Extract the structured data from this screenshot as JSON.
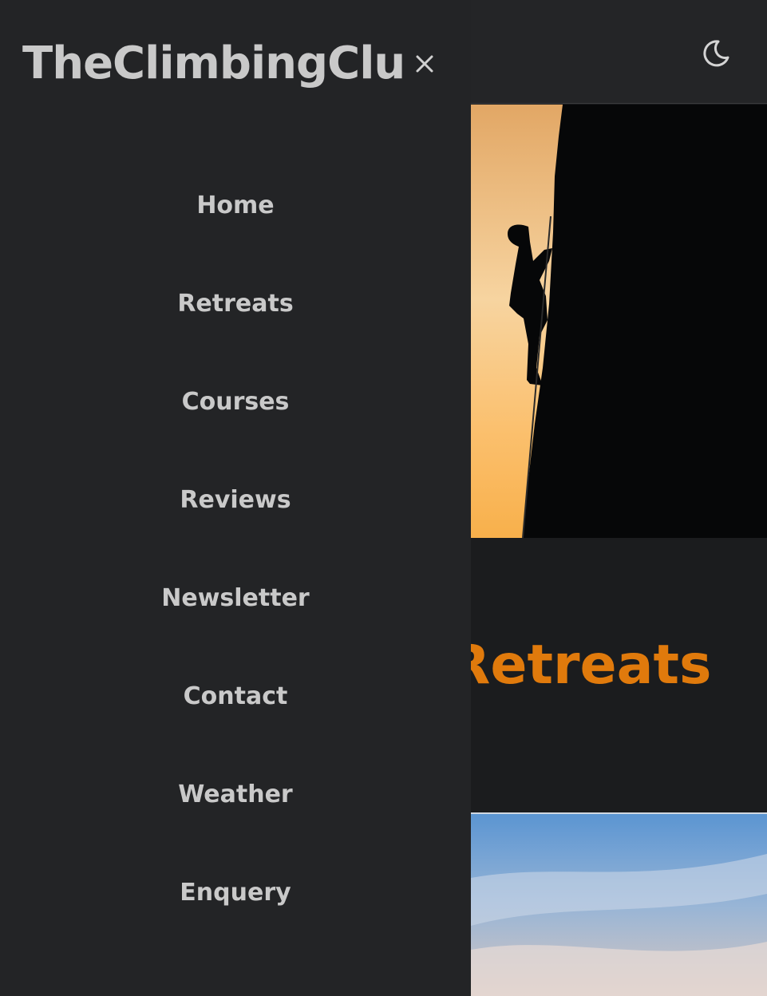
{
  "app": {
    "brand": "TheClimbingClub"
  },
  "header": {
    "theme_toggle_icon": "moon-icon"
  },
  "drawer": {
    "close_icon": "close-icon",
    "close_label": "×",
    "items": [
      {
        "label": "Home"
      },
      {
        "label": "Retreats"
      },
      {
        "label": "Courses"
      },
      {
        "label": "Reviews"
      },
      {
        "label": "Newsletter"
      },
      {
        "label": "Contact"
      },
      {
        "label": "Weather"
      },
      {
        "label": "Enquery"
      }
    ]
  },
  "main": {
    "section_title": "Retreats",
    "accent_color": "#e07a0c"
  }
}
